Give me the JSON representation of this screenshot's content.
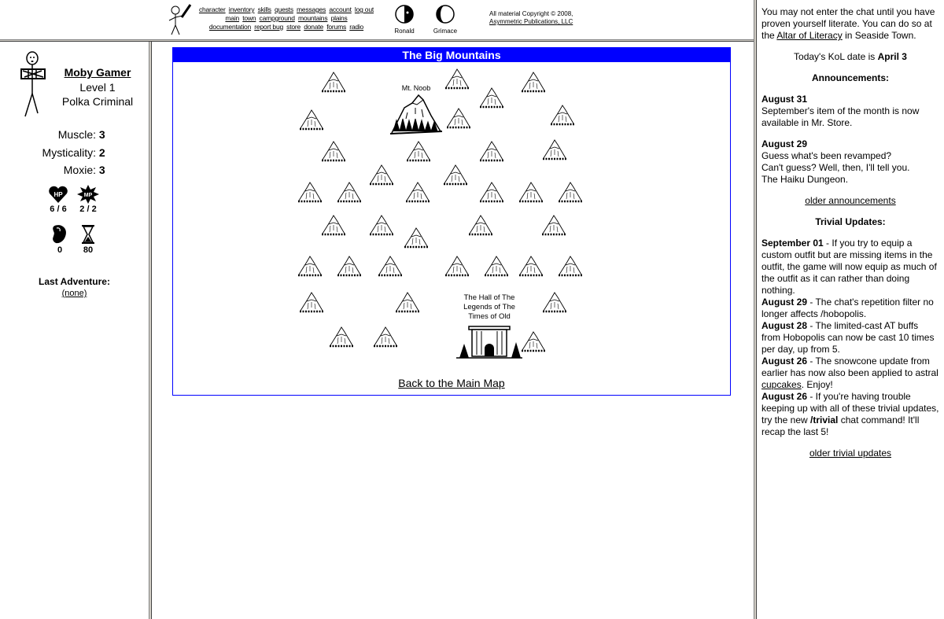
{
  "top_menu": {
    "row1": [
      "character",
      "inventory",
      "skills",
      "quests",
      "messages",
      "account",
      "log out"
    ],
    "row2": [
      "main",
      "town",
      "campground",
      "mountains",
      "plains"
    ],
    "row3": [
      "documentation",
      "report bug",
      "store",
      "donate",
      "forums",
      "radio"
    ]
  },
  "moons": [
    {
      "name": "Ronald",
      "icon": "moon-half-icon"
    },
    {
      "name": "Grimace",
      "icon": "moon-crescent-icon"
    }
  ],
  "copyright": {
    "line1": "All material Copyright © 2008,",
    "link": "Asymmetric Publications, LLC"
  },
  "character": {
    "name": "Moby Gamer",
    "level": "Level 1",
    "class": "Polka Criminal",
    "stats": [
      {
        "label": "Muscle:",
        "value": "3"
      },
      {
        "label": "Mysticality:",
        "value": "2"
      },
      {
        "label": "Moxie:",
        "value": "3"
      }
    ],
    "hp": "6 / 6",
    "mp": "2 / 2",
    "meat": "0",
    "adventures": "80",
    "hp_label": "HP",
    "mp_label": "MP",
    "last_adventure_title": "Last Adventure:",
    "last_adventure": "(none)"
  },
  "main": {
    "title": "The Big Mountains",
    "locations": [
      {
        "name": "Mt. Noob"
      },
      {
        "name": "The Hall of The Legends of The Times of Old"
      }
    ],
    "mt_noob_label": "Mt. Noob",
    "hall_label_1": "The Hall of The",
    "hall_label_2": "Legends of The",
    "hall_label_3": "Times of Old",
    "back_link": "Back to the Main Map"
  },
  "right_pane": {
    "chat_notice_1": "You may not enter the chat until you have proven yourself literate. You can do so at the ",
    "chat_notice_link": "Altar of Literacy",
    "chat_notice_2": " in Seaside Town.",
    "date_prefix": "Today's KoL date is ",
    "date": "April 3",
    "announcements_title": "Announcements:",
    "announcements": [
      {
        "date": "August 31",
        "text": "September's item of the month is now available in Mr. Store."
      },
      {
        "date": "August 29",
        "lines": [
          "Guess what's been revamped?",
          "Can't guess? Well, then, I'll tell you.",
          "The Haiku Dungeon."
        ]
      }
    ],
    "older_announcements": "older announcements",
    "trivial_title": "Trivial Updates:",
    "trivial": [
      {
        "date": "September 01",
        "text": " - If you try to equip a custom outfit but are missing items in the outfit, the game will now equip as much of the outfit as it can rather than doing nothing."
      },
      {
        "date": "August 29",
        "text": " - The chat's repetition filter no longer affects /hobopolis."
      },
      {
        "date": "August 28",
        "text": " - The limited-cast AT buffs from Hobopolis can now be cast 10 times per day, up from 5."
      },
      {
        "date": "August 26",
        "text_before": " - The snowcone update from earlier has now also been applied to astral ",
        "link": "cupcakes",
        "text_after": ". Enjoy!"
      },
      {
        "date": "August 26",
        "text_before": " - If you're having trouble keeping up with all of these trivial updates, try the new ",
        "bold": "/trivial",
        "text_after": " chat command! It'll recap the last 5!"
      }
    ],
    "older_trivial": "older trivial updates"
  }
}
